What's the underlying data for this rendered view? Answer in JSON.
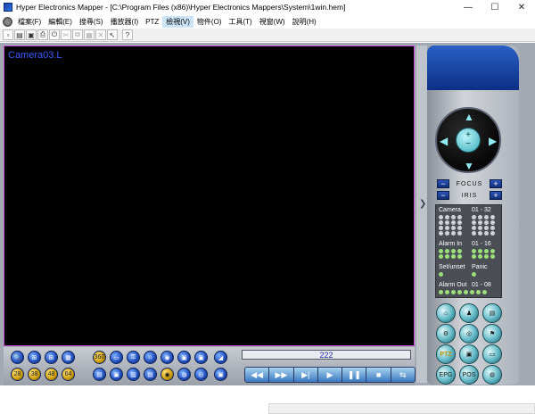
{
  "window": {
    "title": "Hyper Electronics Mapper - [C:\\Program Files (x86)\\Hyper Electronics Mappers\\System\\1win.hem]",
    "ctrl_min": "—",
    "ctrl_max": "☐",
    "ctrl_close": "✕"
  },
  "menu": {
    "items": [
      "檔案(F)",
      "編輯(E)",
      "搜尋(S)",
      "播放器(I)",
      "PTZ",
      "檢視(V)",
      "物件(O)",
      "工具(T)",
      "視窗(W)",
      "說明(H)"
    ]
  },
  "toolbar": {
    "icons": [
      "new-icon",
      "open-icon",
      "save-icon",
      "print-icon",
      "power-icon",
      "cut-icon",
      "copy-icon",
      "paste-icon",
      "delete-icon",
      "select-icon",
      "help-icon"
    ],
    "glyphs": [
      "▫",
      "▤",
      "▣",
      "⎙",
      "⏻",
      "✂",
      "⧉",
      "▦",
      "✕",
      "↖",
      "?"
    ]
  },
  "video": {
    "camera_label": "Camera03.L"
  },
  "bottom": {
    "channel_value": "222",
    "row1_buttons": [
      "🔍",
      "⊞",
      "⊞",
      "▦",
      "360",
      "▭",
      "⚿",
      "⌂",
      "◉",
      "▣",
      "▣",
      "◢"
    ],
    "row2_buttons": [
      "28",
      "38",
      "48",
      "64",
      "▤",
      "▣",
      "▥",
      "▤",
      "◉",
      "◍",
      "◎",
      "▣"
    ],
    "transport": [
      "◀◀",
      "▶▶",
      "▶|",
      "▶",
      "❚❚",
      "■",
      "⇆"
    ]
  },
  "panel": {
    "focus_label": "FOCUS",
    "iris_label": "IRIS",
    "minus": "−",
    "plus": "+",
    "status": {
      "camera_label": "Camera",
      "camera_range": "01 - 32",
      "alarm_in_label": "Alarm In",
      "alarm_in_range": "01 - 16",
      "set_unset_label": "Set/unset",
      "panic_label": "Panic",
      "alarm_out_label": "Alarm Out",
      "alarm_out_range": "01 - 08"
    },
    "func_buttons": [
      "⌂",
      "♟",
      "▤",
      "⚙",
      "◎",
      "⚑",
      "PTZ",
      "▣",
      "▭",
      "EPG",
      "POS",
      "◍"
    ]
  }
}
